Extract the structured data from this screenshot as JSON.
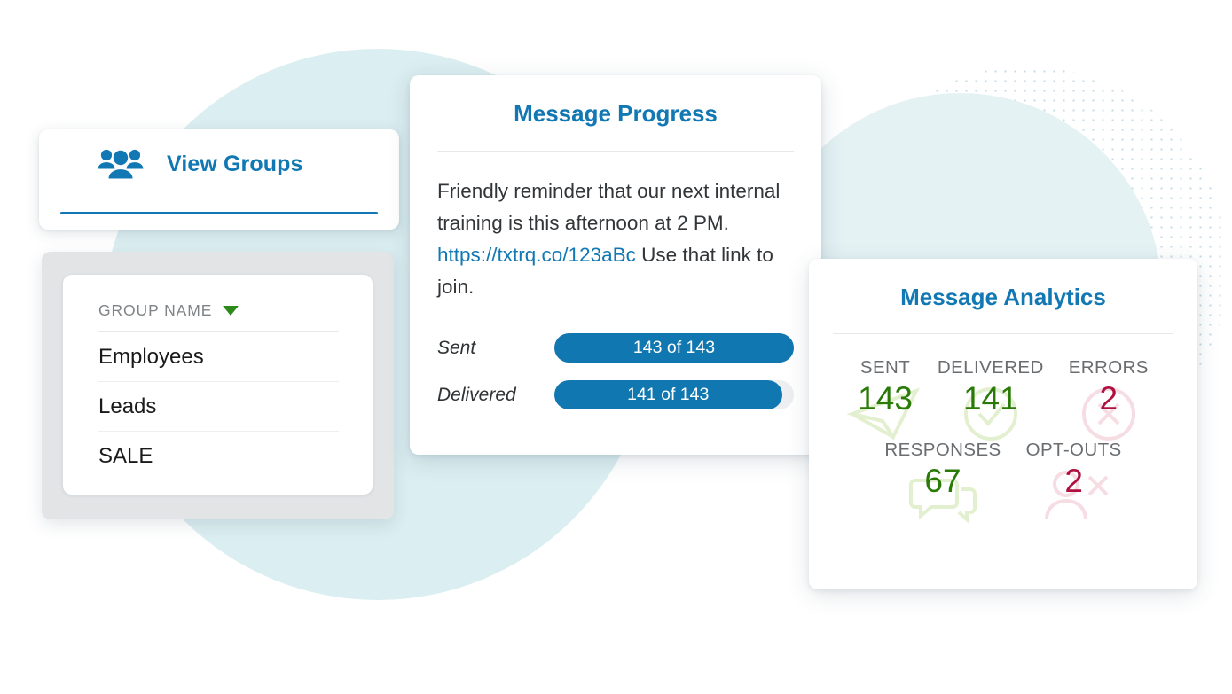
{
  "view_groups": {
    "icon": "people-group-icon",
    "label": "View Groups"
  },
  "group_list": {
    "header": "GROUP NAME",
    "sort_icon": "caret-down-icon",
    "rows": [
      "Employees",
      "Leads",
      "SALE"
    ]
  },
  "message_progress": {
    "title": "Message Progress",
    "body_before": "Friendly reminder that our next internal training is this afternoon at 2 PM. ",
    "link": "https://txtrq.co/123aBc",
    "body_after": " Use that link to join.",
    "bars": [
      {
        "label": "Sent",
        "text": "143 of 143",
        "value": 143,
        "total": 143,
        "percent": 100
      },
      {
        "label": "Delivered",
        "text": "141 of 143",
        "value": 141,
        "total": 143,
        "percent": 95
      }
    ]
  },
  "message_analytics": {
    "title": "Message Analytics",
    "stats_top": [
      {
        "label": "SENT",
        "value": "143",
        "color": "green",
        "watermark": "paper-plane-icon"
      },
      {
        "label": "DELIVERED",
        "value": "141",
        "color": "green",
        "watermark": "check-circle-icon"
      },
      {
        "label": "ERRORS",
        "value": "2",
        "color": "red",
        "watermark": "error-circle-icon"
      }
    ],
    "stats_bottom": [
      {
        "label": "RESPONSES",
        "value": "67",
        "color": "green",
        "watermark": "chat-bubbles-icon"
      },
      {
        "label": "OPT-OUTS",
        "value": "2",
        "color": "red",
        "watermark": "person-remove-icon"
      }
    ]
  },
  "colors": {
    "brand_blue": "#1278b3",
    "bar_blue": "#1077b0",
    "stat_green": "#2a7a08",
    "stat_red": "#b01040",
    "sort_green": "#2d8a1a",
    "circle_teal": "#dbeef1",
    "track_grey": "#eceef0"
  }
}
